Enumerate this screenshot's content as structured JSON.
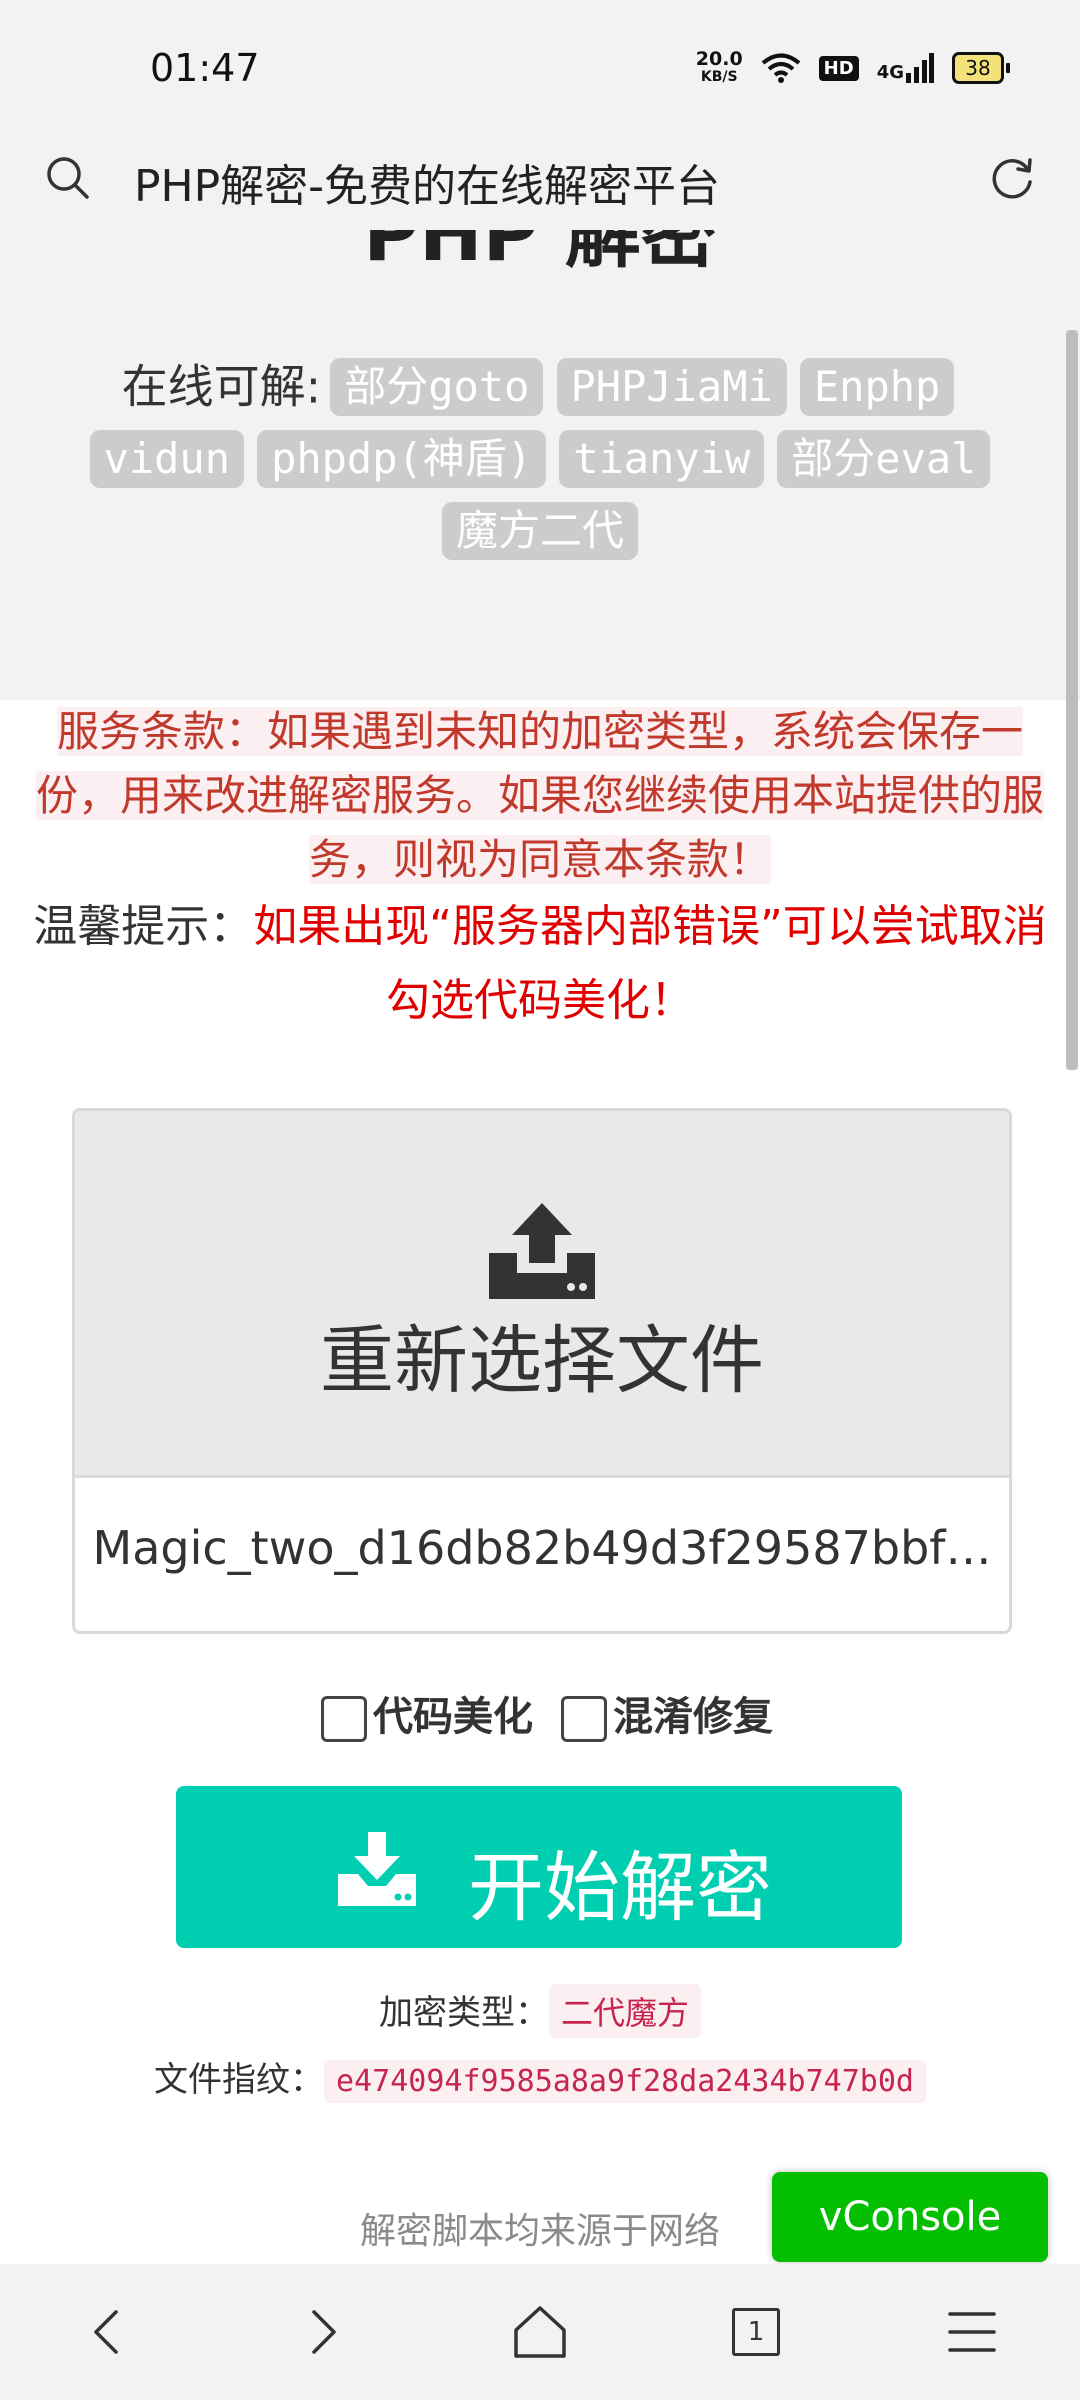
{
  "status_bar": {
    "time": "01:47",
    "net_speed_value": "20.0",
    "net_speed_unit": "KB/S",
    "hd_label": "HD",
    "network_label": "4G",
    "battery_level": "38"
  },
  "browser": {
    "page_title": "PHP解密-免费的在线解密平台"
  },
  "header": {
    "big_title_partial": "PHP 解密",
    "support_label": "在线可解:",
    "tags": [
      "部分goto",
      "PHPJiaMi",
      "Enphp",
      "vidun",
      "phpdp(神盾)",
      "tianyiw",
      "部分eval",
      "魔方二代"
    ]
  },
  "notices": {
    "terms": "服务条款：如果遇到未知的加密类型，系统会保存一份，用来改进解密服务。如果您继续使用本站提供的服务，则视为同意本条款！",
    "tip_label": "温馨提示：",
    "tip_text": "如果出现“服务器内部错误”可以尝试取消勾选代码美化！"
  },
  "upload": {
    "button_label": "重新选择文件",
    "filename": "Magic_two_d16db82b49d3f29587bbf…"
  },
  "options": {
    "beautify_label": "代码美化",
    "beautify_checked": false,
    "repair_label": "混淆修复",
    "repair_checked": false
  },
  "decrypt_button": {
    "label": "开始解密"
  },
  "result": {
    "type_label": "加密类型：",
    "type_value": "二代魔方",
    "fingerprint_label": "文件指纹：",
    "fingerprint_value": "e474094f9585a8a9f28da2434b747b0d"
  },
  "footer": {
    "text": "解密脚本均来源于网络",
    "vconsole_label": "vConsole"
  },
  "colors": {
    "accent": "#00ceb1",
    "tag_bg": "#cccccc",
    "vconsole": "#04be02",
    "warning_red": "#e00000",
    "code_pink": "#c7254e"
  },
  "icons": [
    "search-icon",
    "refresh-icon",
    "upload-icon",
    "download-icon",
    "back-icon",
    "forward-icon",
    "home-icon",
    "tabs-icon",
    "menu-icon",
    "wifi-icon",
    "signal-icon",
    "battery-icon"
  ],
  "bottom_nav": {
    "tab_count": "1"
  }
}
